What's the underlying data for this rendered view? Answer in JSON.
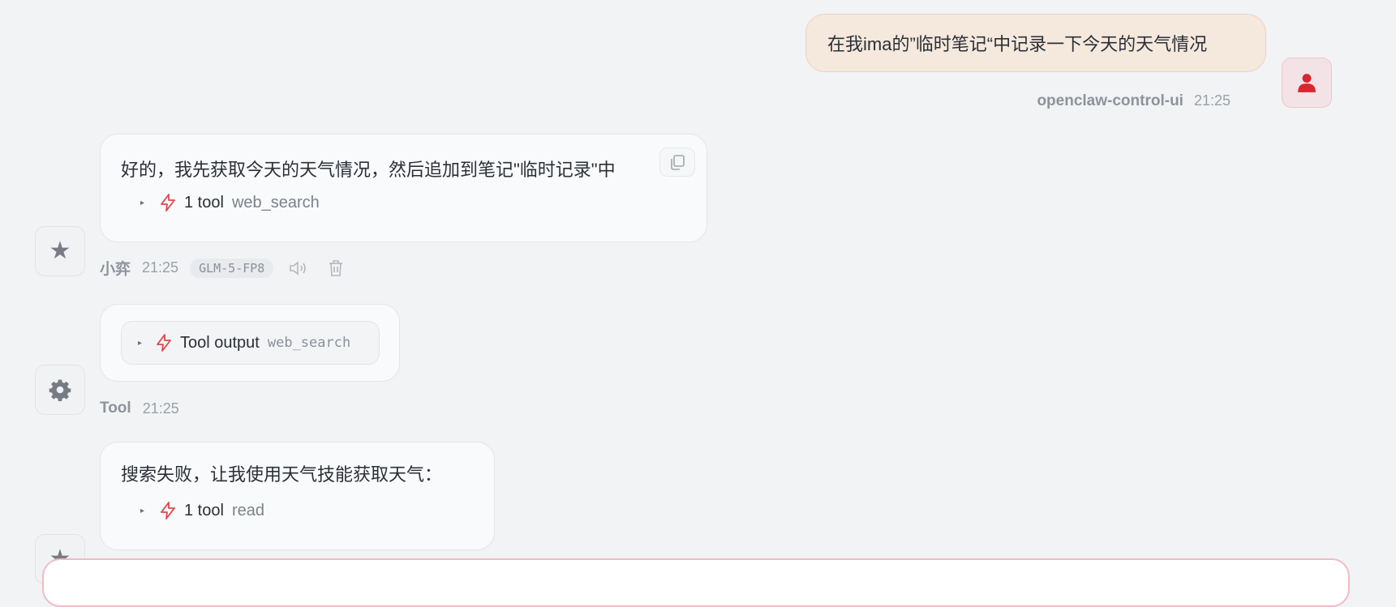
{
  "user_message": {
    "text": "在我ima的”临时笔记“中记录一下今天的天气情况",
    "sender": "openclaw-control-ui",
    "time": "21:25"
  },
  "assistant_message_1": {
    "text": "好的，我先获取今天的天气情况，然后追加到笔记\"临时记录\"中",
    "tool_count": "1 tool",
    "tool_name": "web_search",
    "sender": "小弈",
    "time": "21:25",
    "model": "GLM-5-FP8"
  },
  "tool_message": {
    "label": "Tool output",
    "tool_name": "web_search",
    "sender": "Tool",
    "time": "21:25"
  },
  "assistant_message_2": {
    "text": "搜索失败，让我使用天气技能获取天气：",
    "tool_count": "1 tool",
    "tool_name": "read"
  },
  "icons": {
    "user_avatar": "person-icon",
    "assistant_avatar": "star-icon",
    "tool_avatar": "gear-icon",
    "tool": "lightning-icon",
    "copy": "copy-icon",
    "speaker": "speaker-icon",
    "delete": "trash-icon"
  },
  "colors": {
    "accent": "#e0474c",
    "user_bubble": "#f5e8dd",
    "background": "#f2f3f5"
  }
}
